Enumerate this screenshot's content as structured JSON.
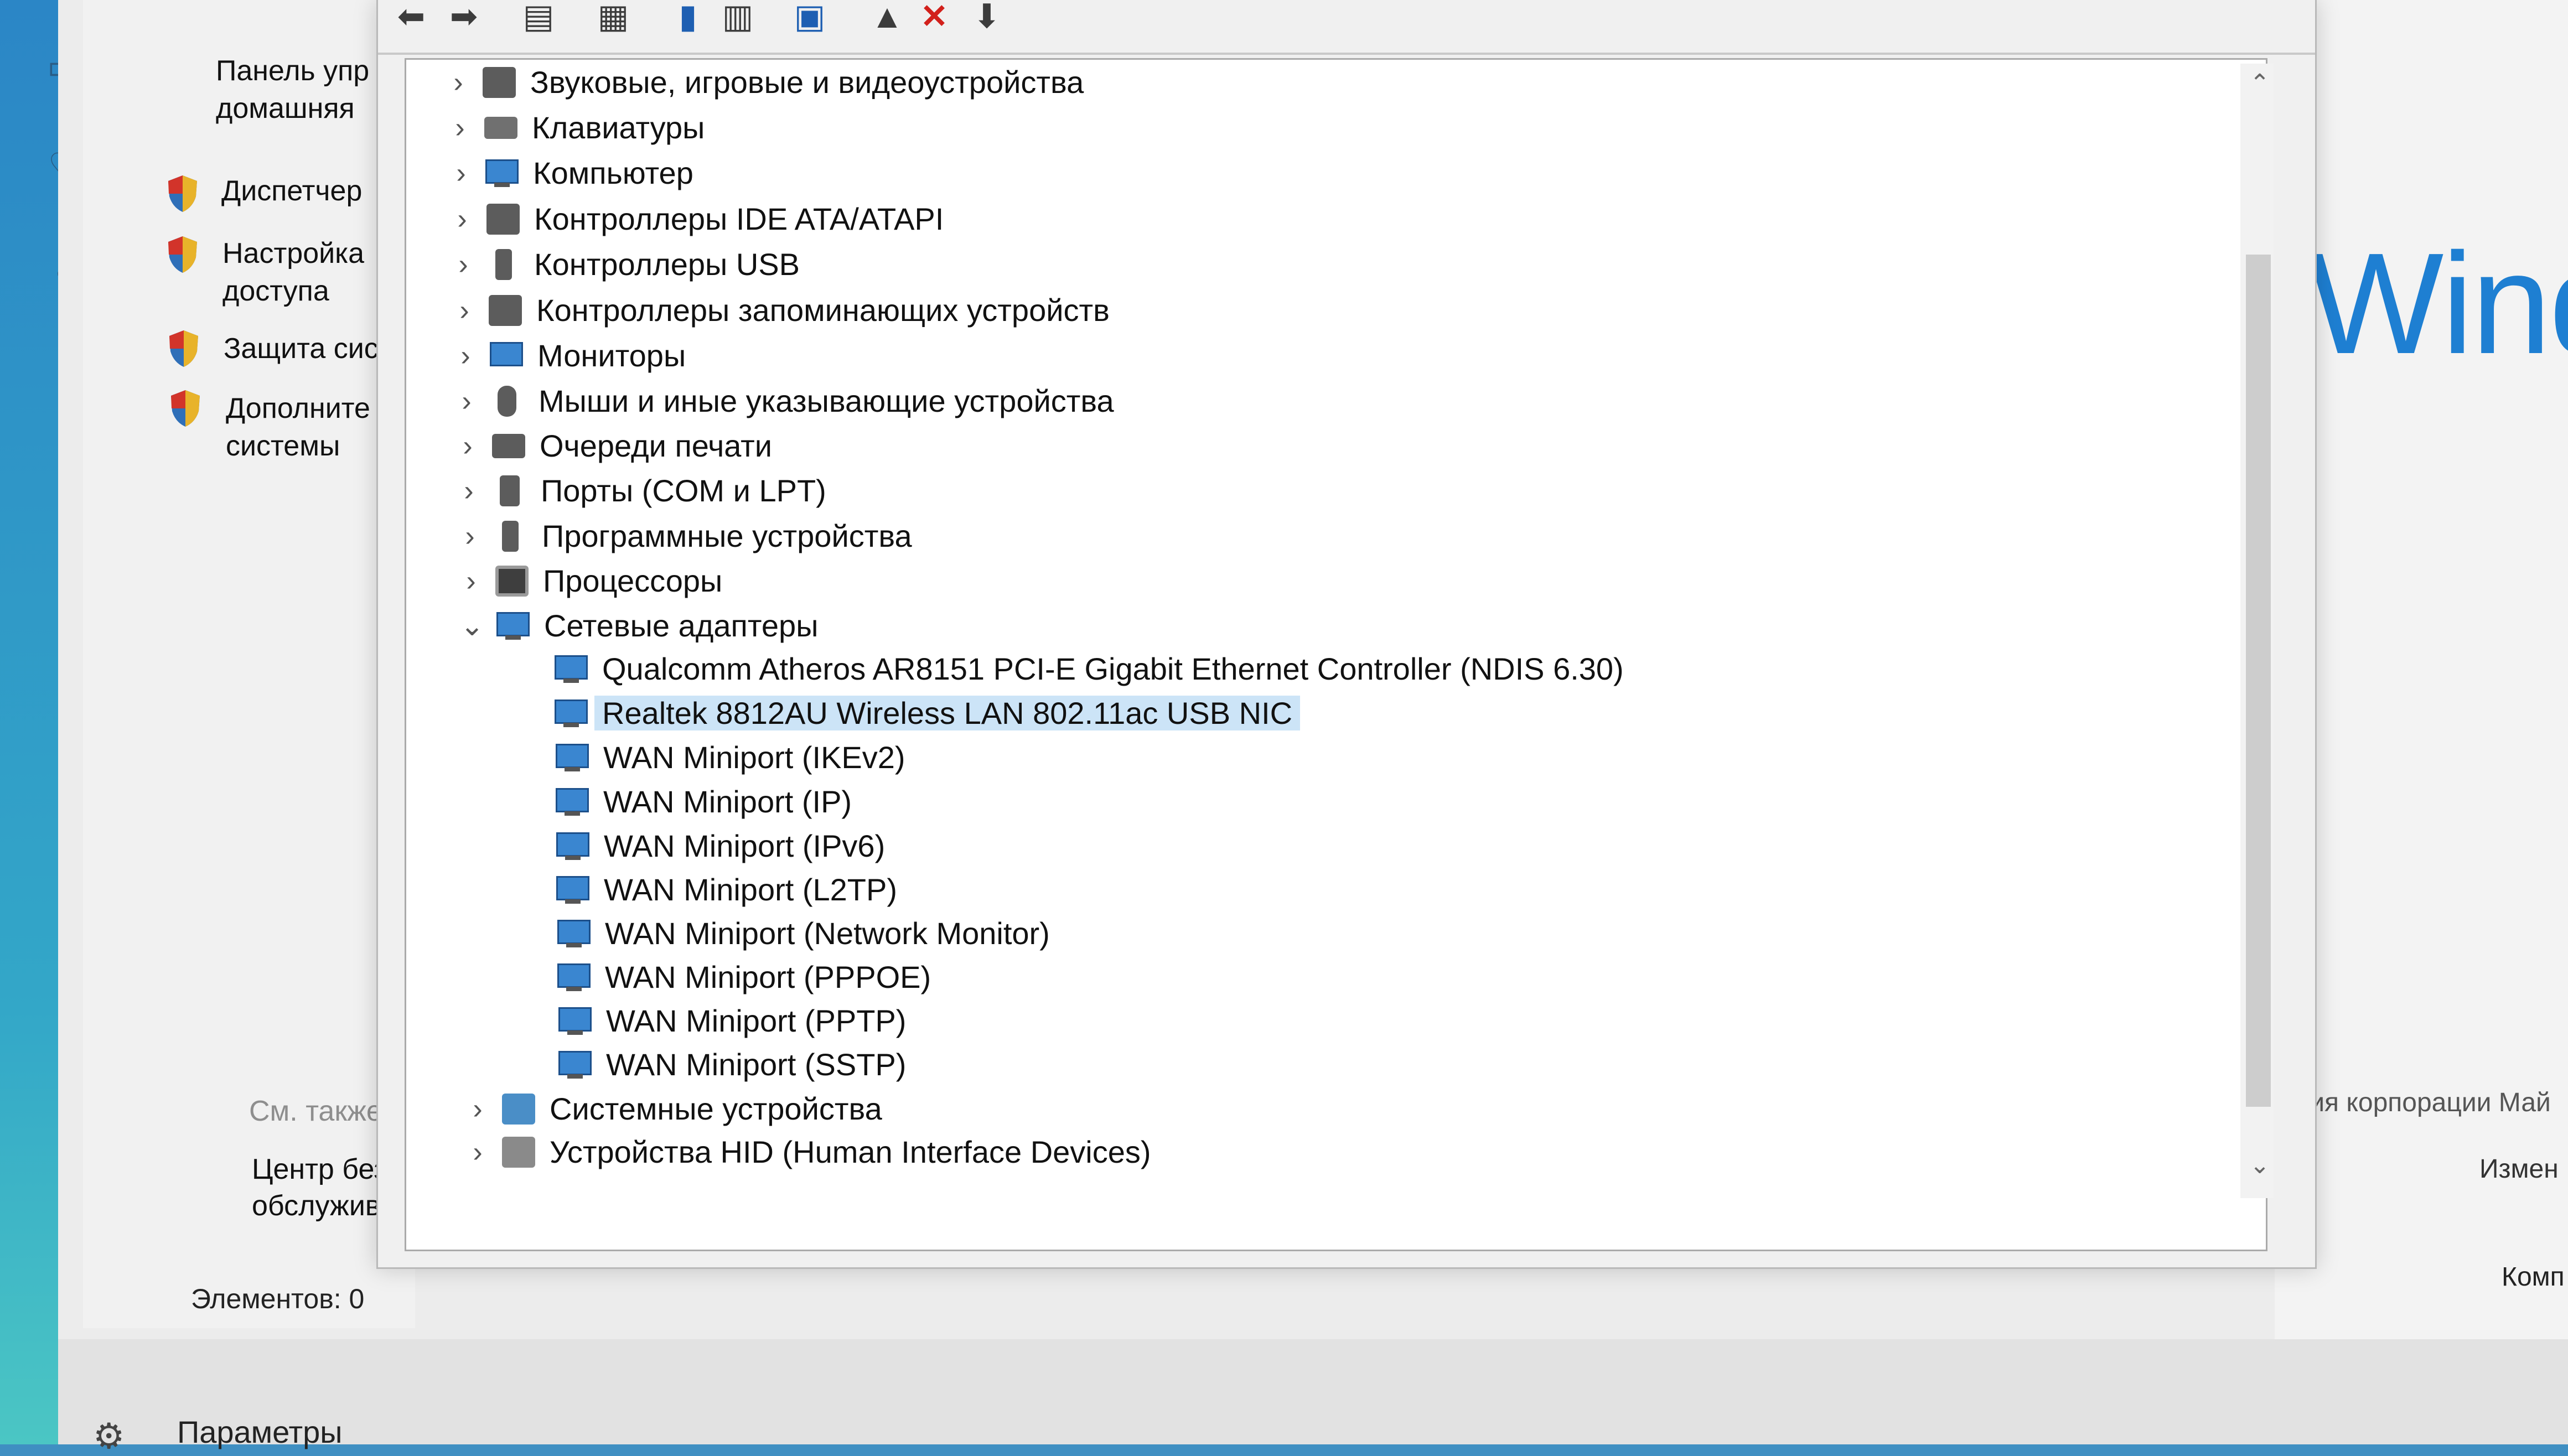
{
  "control_panel": {
    "nav_partial_1": "Панель упр",
    "nav_partial_2": "домашняя",
    "links": [
      {
        "line1": "Диспетчер",
        "line2": ""
      },
      {
        "line1": "Настройка",
        "line2": "доступа"
      },
      {
        "line1": "Защита сис",
        "line2": ""
      },
      {
        "line1": "Дополните",
        "line2": "системы"
      }
    ],
    "see_also": "См. также",
    "security_center_1": "Центр безо",
    "security_center_2": "обслужива",
    "status": "Элементов: 0",
    "bottom_label": "Параметры"
  },
  "right_panel": {
    "logo_text": "Wind",
    "copyright_text": "ения корпорации Май",
    "change_text": "Измен",
    "computer_text": "Комп"
  },
  "device_manager": {
    "categories_before": [
      {
        "label": "Звуковые, игровые и видеоустройства",
        "icon": "speaker-icon"
      },
      {
        "label": "Клавиатуры",
        "icon": "keyboard-icon"
      },
      {
        "label": "Компьютер",
        "icon": "computer-icon"
      },
      {
        "label": "Контроллеры IDE ATA/ATAPI",
        "icon": "ide-controller-icon"
      },
      {
        "label": "Контроллеры USB",
        "icon": "usb-icon"
      },
      {
        "label": "Контроллеры запоминающих устройств",
        "icon": "storage-controller-icon"
      },
      {
        "label": "Мониторы",
        "icon": "monitor-icon"
      },
      {
        "label": "Мыши и иные указывающие устройства",
        "icon": "mouse-icon"
      },
      {
        "label": "Очереди печати",
        "icon": "printer-icon"
      },
      {
        "label": "Порты (COM и LPT)",
        "icon": "port-icon"
      },
      {
        "label": "Программные устройства",
        "icon": "software-device-icon"
      },
      {
        "label": "Процессоры",
        "icon": "processor-icon"
      }
    ],
    "network_category": {
      "label": "Сетевые адаптеры",
      "icon": "network-adapter-icon",
      "expanded": true
    },
    "network_adapters": [
      {
        "label": "Qualcomm Atheros AR8151 PCI-E Gigabit Ethernet Controller (NDIS 6.30)",
        "selected": false
      },
      {
        "label": "Realtek 8812AU Wireless LAN 802.11ac USB NIC",
        "selected": true
      },
      {
        "label": "WAN Miniport (IKEv2)",
        "selected": false
      },
      {
        "label": "WAN Miniport (IP)",
        "selected": false
      },
      {
        "label": "WAN Miniport (IPv6)",
        "selected": false
      },
      {
        "label": "WAN Miniport (L2TP)",
        "selected": false
      },
      {
        "label": "WAN Miniport (Network Monitor)",
        "selected": false
      },
      {
        "label": "WAN Miniport (PPPOE)",
        "selected": false
      },
      {
        "label": "WAN Miniport (PPTP)",
        "selected": false
      },
      {
        "label": "WAN Miniport (SSTP)",
        "selected": false
      }
    ],
    "categories_after": [
      {
        "label": "Системные устройства",
        "icon": "system-devices-icon"
      },
      {
        "label": "Устройства HID (Human Interface Devices)",
        "icon": "hid-icon"
      }
    ]
  },
  "colors": {
    "selection": "#cce4f7",
    "windows_accent": "#1e7fd2",
    "remove_red": "#d2201b"
  }
}
